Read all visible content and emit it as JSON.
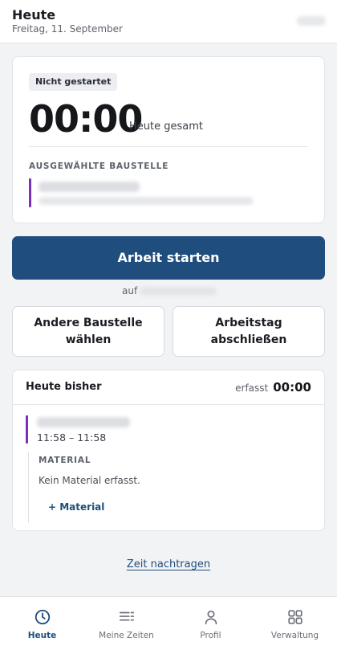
{
  "header": {
    "title": "Heute",
    "date": "Freitag, 11. September"
  },
  "status_card": {
    "badge": "Nicht gestartet",
    "timer": "00:00",
    "timer_label": "Heute gesamt",
    "section_label": "AUSGEWÄHLTE BAUSTELLE"
  },
  "actions": {
    "start_label": "Arbeit starten",
    "auf_label": "auf",
    "change_site_label": "Andere Baustelle wählen",
    "finish_day_label": "Arbeitstag abschließen"
  },
  "today": {
    "title": "Heute bisher",
    "erfasst_label": "erfasst",
    "erfasst_value": "00:00",
    "entry": {
      "time_range": "11:58 – 11:58"
    },
    "material": {
      "label": "MATERIAL",
      "empty_text": "Kein Material erfasst.",
      "add_label": "+ Material"
    }
  },
  "backfill_link": "Zeit nachtragen",
  "nav": {
    "items": [
      {
        "label": "Heute",
        "icon": "clock-icon"
      },
      {
        "label": "Meine Zeiten",
        "icon": "list-icon"
      },
      {
        "label": "Profil",
        "icon": "person-icon"
      },
      {
        "label": "Verwaltung",
        "icon": "grid-icon"
      }
    ]
  },
  "colors": {
    "primary": "#1f4e7e",
    "site_accent": "#7b2fbf",
    "background": "#f2f3f5"
  }
}
